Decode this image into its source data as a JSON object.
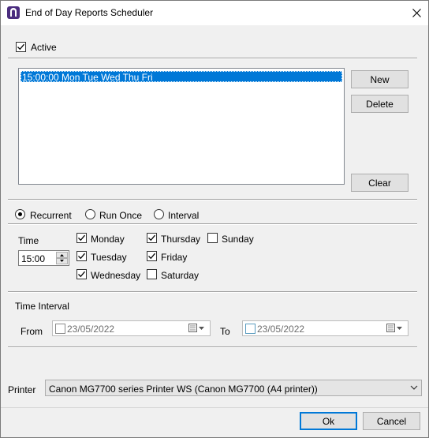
{
  "window": {
    "title": "End of Day Reports Scheduler",
    "icons": {
      "app": "app-logo-icon",
      "close": "close-icon"
    }
  },
  "active": {
    "label": "Active",
    "checked": true
  },
  "schedule_list": {
    "items": [
      "15:00:00 Mon Tue Wed Thu Fri"
    ],
    "selected_index": 0
  },
  "buttons": {
    "new": "New",
    "delete": "Delete",
    "clear": "Clear",
    "ok": "Ok",
    "cancel": "Cancel"
  },
  "mode": {
    "options": [
      "Recurrent",
      "Run Once",
      "Interval"
    ],
    "selected": "Recurrent"
  },
  "time": {
    "label": "Time",
    "value": "15:00"
  },
  "days": [
    {
      "label": "Monday",
      "checked": true
    },
    {
      "label": "Tuesday",
      "checked": true
    },
    {
      "label": "Wednesday",
      "checked": true
    },
    {
      "label": "Thursday",
      "checked": true
    },
    {
      "label": "Friday",
      "checked": true
    },
    {
      "label": "Saturday",
      "checked": false
    },
    {
      "label": "Sunday",
      "checked": false
    }
  ],
  "time_interval": {
    "heading": "Time Interval",
    "from_label": "From",
    "to_label": "To",
    "from_date": "23/05/2022",
    "to_date": "23/05/2022"
  },
  "printer": {
    "label": "Printer",
    "selected": "Canon MG7700 series Printer WS (Canon MG7700 (A4 printer))"
  },
  "colors": {
    "accent": "#0078d7",
    "app_icon": "#4b2d7f"
  }
}
